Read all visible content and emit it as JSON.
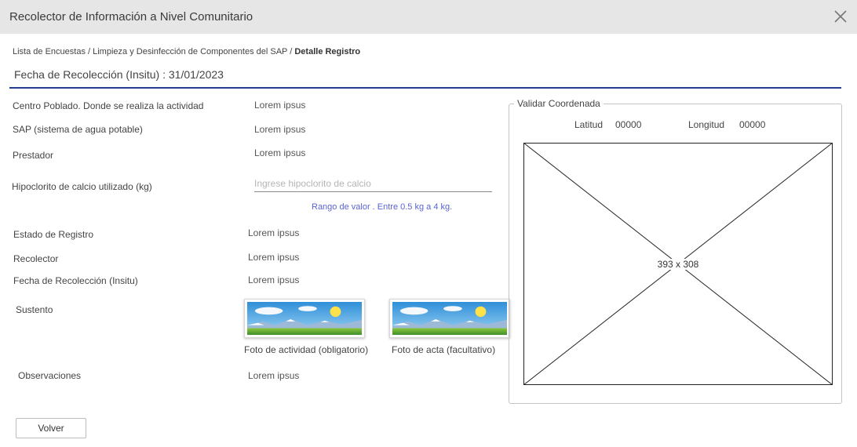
{
  "window": {
    "title": "Recolector de Información a Nivel Comunitario",
    "close_icon": "close-icon"
  },
  "breadcrumb": {
    "items": [
      "Lista de Encuestas",
      "Limpieza y Desinfección de Componentes del SAP"
    ],
    "separator": " / ",
    "current": "Detalle Registro"
  },
  "header": {
    "date_label": "Fecha de Recolección (Insitu) : 31/01/2023"
  },
  "form": {
    "centro_poblado": {
      "label": "Centro Poblado. Donde se realiza la actividad",
      "value": "Lorem ipsus"
    },
    "sap": {
      "label": "SAP (sistema de agua potable)",
      "value": "Lorem ipsus"
    },
    "prestador": {
      "label": "Prestador",
      "value": "Lorem ipsus"
    },
    "hipoclorito": {
      "label": "Hipoclorito de calcio utilizado (kg)",
      "placeholder": "Ingrese hipoclorito de calcio",
      "value": "",
      "hint": "Rango de valor . Entre 0.5 kg a 4 kg."
    },
    "estado": {
      "label": "Estado de Registro",
      "value": "Lorem ipsus"
    },
    "recolector": {
      "label": "Recolector",
      "value": "Lorem ipsus"
    },
    "fecha": {
      "label": "Fecha de Recolección (Insitu)",
      "value": "Lorem ipsus"
    },
    "sustento": {
      "label": "Sustento",
      "photos": [
        {
          "caption": "Foto de actividad (obligatorio)",
          "icon": "landscape-image-icon"
        },
        {
          "caption": "Foto de acta (facultativo)",
          "icon": "landscape-image-icon"
        }
      ]
    },
    "observaciones": {
      "label": "Observaciones",
      "value": "Lorem ipsus"
    }
  },
  "coordinates": {
    "legend": "Validar Coordenada",
    "latitud_label": "Latitud",
    "latitud_value": "00000",
    "longitud_label": "Longitud",
    "longitud_value": "00000",
    "map_placeholder": "393 x 308"
  },
  "actions": {
    "back_label": "Volver"
  },
  "colors": {
    "accent_rule": "#23408e",
    "hint_text": "#5b63d6",
    "titlebar_bg": "#e6e6e6"
  }
}
